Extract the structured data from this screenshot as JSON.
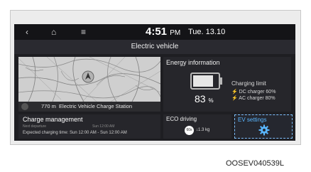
{
  "status_bar": {
    "back_icon": "back-arrow-icon",
    "home_icon": "home-icon",
    "menu_icon": "menu-icon",
    "time": "4:51",
    "ampm": "PM",
    "date": "Tue. 13.10"
  },
  "title": "Electric vehicle",
  "map": {
    "distance": "770 m",
    "destination": "Electric Vehicle Charge Station"
  },
  "charge_management": {
    "title": "Charge management",
    "next_departure": "Next departure",
    "departure_time": "Sun 12:00 AM",
    "expected": "Expected charging time: Sun 12:00 AM - Sun 12:00 AM"
  },
  "energy": {
    "title": "Energy information",
    "battery_percent": "83",
    "battery_unit": "%",
    "battery_level": 0.83,
    "charging_limit_title": "Charging limit",
    "dc_charger": "DC charger 60%",
    "ac_charger": "AC charger 80%"
  },
  "eco": {
    "title": "ECO driving",
    "badge": "60s",
    "value": "1.3 kg"
  },
  "ev_settings": {
    "title": "EV settings",
    "icon": "gear-icon"
  },
  "figure_code": "OOSEV040539L",
  "colors": {
    "accent": "#59b6ff",
    "screen_bg": "#1e1e22",
    "panel_bg": "#26262b"
  }
}
